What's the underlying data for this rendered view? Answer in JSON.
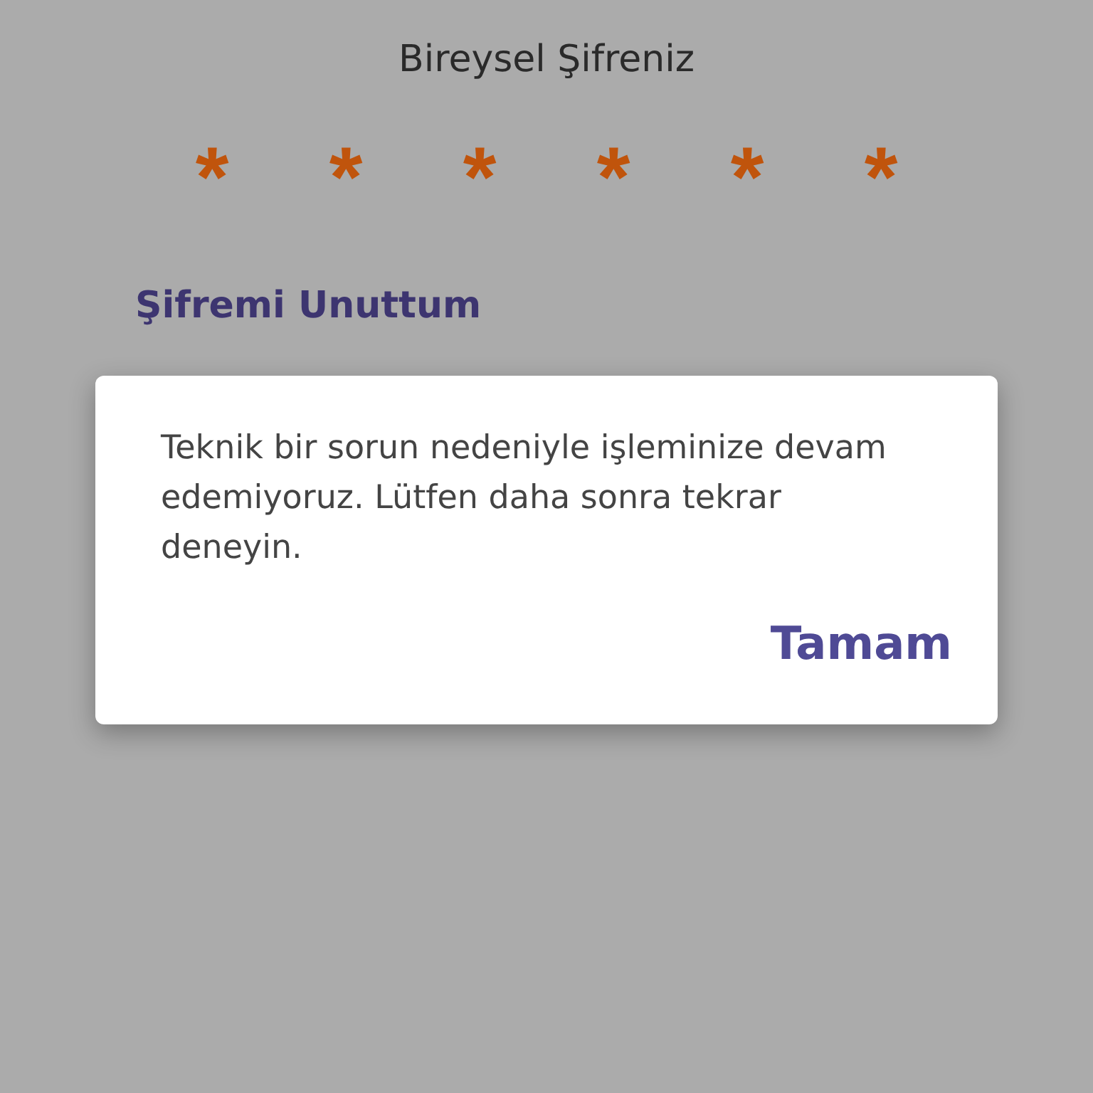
{
  "screen": {
    "title": "Bireysel Şifreniz",
    "pin_digits": [
      "*",
      "*",
      "*",
      "*",
      "*",
      "*"
    ],
    "forgot_link": "Şifremi Unuttum"
  },
  "dialog": {
    "message": "Teknik bir sorun nedeniyle işleminize devam edemiyoruz. Lütfen daha sonra tekrar deneyin.",
    "buttons": [
      "Tamam"
    ]
  }
}
